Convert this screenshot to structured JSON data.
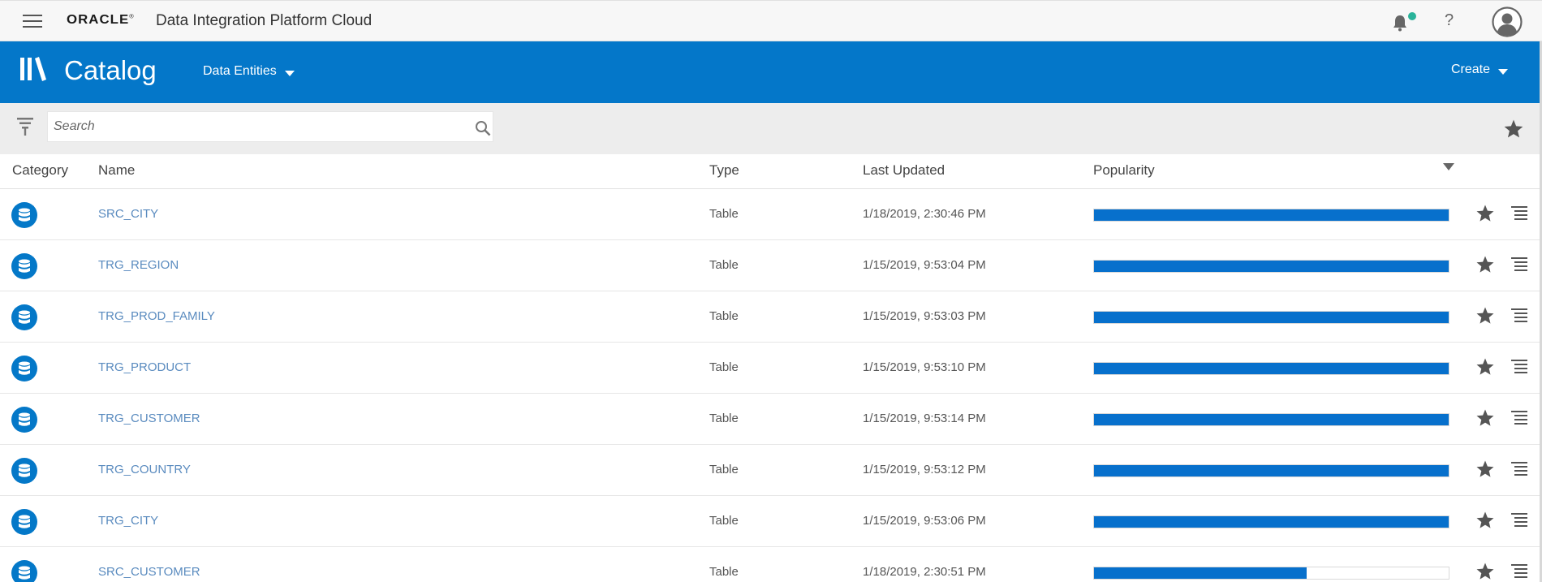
{
  "topbar": {
    "logo_text": "ORACLE",
    "trademark": "®",
    "app_title": "Data Integration Platform Cloud",
    "help_label": "?",
    "notification_dot_color": "#2ab39a"
  },
  "catalog": {
    "title": "Catalog",
    "entities_label": "Data Entities",
    "create_label": "Create",
    "accent_color": "#0477c9"
  },
  "search": {
    "placeholder": "Search",
    "value": ""
  },
  "table": {
    "columns": {
      "category": "Category",
      "name": "Name",
      "type": "Type",
      "last_updated": "Last Updated",
      "popularity": "Popularity"
    },
    "rows": [
      {
        "name": "SRC_CITY",
        "type": "Table",
        "last_updated": "1/18/2019, 2:30:46 PM",
        "popularity": 1.0
      },
      {
        "name": "TRG_REGION",
        "type": "Table",
        "last_updated": "1/15/2019, 9:53:04 PM",
        "popularity": 1.0
      },
      {
        "name": "TRG_PROD_FAMILY",
        "type": "Table",
        "last_updated": "1/15/2019, 9:53:03 PM",
        "popularity": 1.0
      },
      {
        "name": "TRG_PRODUCT",
        "type": "Table",
        "last_updated": "1/15/2019, 9:53:10 PM",
        "popularity": 1.0
      },
      {
        "name": "TRG_CUSTOMER",
        "type": "Table",
        "last_updated": "1/15/2019, 9:53:14 PM",
        "popularity": 1.0
      },
      {
        "name": "TRG_COUNTRY",
        "type": "Table",
        "last_updated": "1/15/2019, 9:53:12 PM",
        "popularity": 1.0
      },
      {
        "name": "TRG_CITY",
        "type": "Table",
        "last_updated": "1/15/2019, 9:53:06 PM",
        "popularity": 1.0
      },
      {
        "name": "SRC_CUSTOMER",
        "type": "Table",
        "last_updated": "1/18/2019, 2:30:51 PM",
        "popularity": 0.6
      }
    ]
  },
  "icons": {
    "menu": "hamburger-icon",
    "bell": "bell-icon",
    "avatar": "user-avatar-icon",
    "catalog": "library-books-icon",
    "filter": "filter-icon",
    "search": "search-icon",
    "favorite": "star-icon",
    "row_actions": "list-menu-icon",
    "category": "database-icon"
  }
}
